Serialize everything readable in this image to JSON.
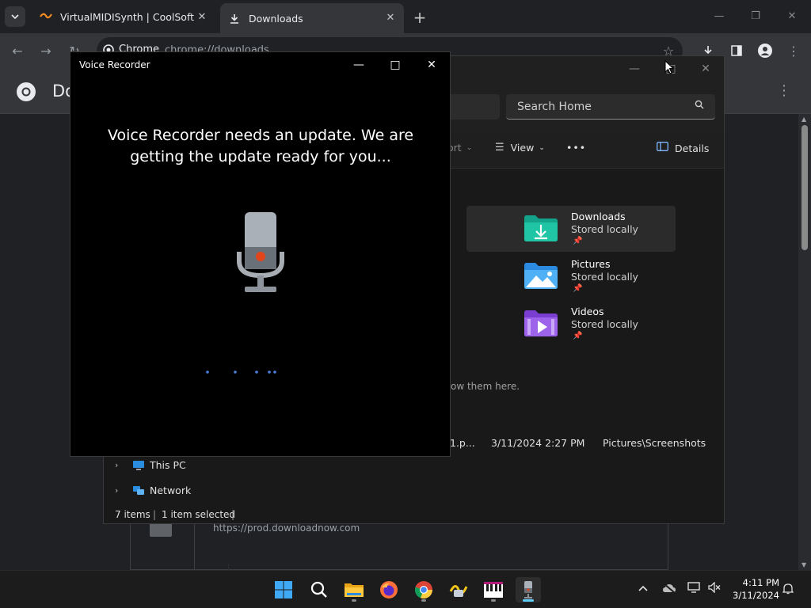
{
  "browser": {
    "tabs": [
      {
        "title": "VirtualMIDISynth | CoolSoft",
        "close": "✕"
      },
      {
        "title": "Downloads",
        "close": "✕"
      }
    ],
    "new_tab": "+",
    "omnibox": {
      "chip": "Chrome",
      "url": "chrome://downloads"
    },
    "page_title": "Do",
    "downloads": {
      "item_url": "https://prod.downloadnow.com"
    }
  },
  "explorer": {
    "search_placeholder": "Search Home",
    "toolbar": {
      "sort": "ort",
      "view": "View",
      "more": "•••",
      "details": "Details"
    },
    "quick_access": [
      {
        "name": "Downloads",
        "status": "Stored locally",
        "selected": true
      },
      {
        "name": "Pictures",
        "status": "Stored locally",
        "selected": false
      },
      {
        "name": "Videos",
        "status": "Stored locally",
        "selected": false
      }
    ],
    "hint_text": "ow them here.",
    "recent_file": {
      "name": "1.p...",
      "date": "3/11/2024 2:27 PM",
      "location": "Pictures\\Screenshots"
    },
    "nav": [
      {
        "label": "This PC"
      },
      {
        "label": "Network"
      }
    ],
    "status": {
      "items": "7 items",
      "selected": "1 item selected"
    }
  },
  "voice_recorder": {
    "title": "Voice Recorder",
    "message": "Voice Recorder needs an update. We are getting the update ready for you..."
  },
  "taskbar": {
    "clock": {
      "time": "4:11 PM",
      "date": "3/11/2024"
    }
  },
  "colors": {
    "accent": "#0067c0",
    "mic_record": "#e0451b",
    "loading_dots": "#4f7fd9"
  }
}
